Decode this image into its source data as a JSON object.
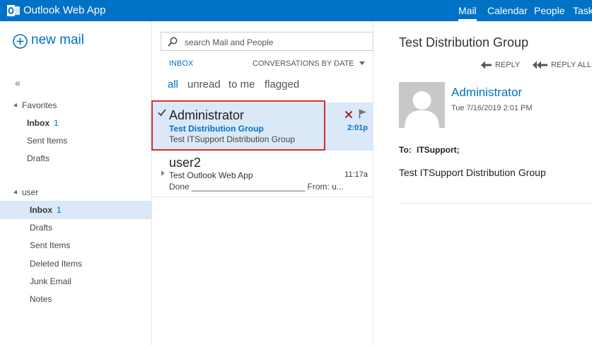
{
  "app": {
    "title": "Outlook Web App"
  },
  "topnav": {
    "mail": "Mail",
    "calendar": "Calendar",
    "people": "People",
    "tasks": "Task"
  },
  "colors": {
    "brand": "#0072c6",
    "selected_bg": "#dae8f7",
    "highlight": "#d62b2b"
  },
  "leftpane": {
    "new_mail": "new mail",
    "collapse": "«",
    "favorites": {
      "header": "Favorites",
      "items": [
        {
          "label": "Inbox",
          "count": "1"
        },
        {
          "label": "Sent Items"
        },
        {
          "label": "Drafts"
        }
      ]
    },
    "user": {
      "header": "user",
      "items": [
        {
          "label": "Inbox",
          "count": "1"
        },
        {
          "label": "Drafts"
        },
        {
          "label": "Sent Items"
        },
        {
          "label": "Deleted Items"
        },
        {
          "label": "Junk Email"
        },
        {
          "label": "Notes"
        }
      ]
    }
  },
  "midpane": {
    "search_placeholder": "search Mail and People",
    "folder_label": "INBOX",
    "sort_label": "CONVERSATIONS BY DATE",
    "filters": [
      "all",
      "unread",
      "to me",
      "flagged"
    ],
    "messages": [
      {
        "sender": "Administrator",
        "subject": "Test Distribution Group",
        "preview": "Test ITSupport Distribution Group",
        "time": "2:01p"
      },
      {
        "sender": "user2",
        "subject": "Test Outlook Web App",
        "preview": "Done ________________________ From: u...",
        "time": "11:17a"
      }
    ]
  },
  "readpane": {
    "subject": "Test Distribution Group",
    "reply": "REPLY",
    "reply_all": "REPLY ALL",
    "sender": "Administrator",
    "date": "Tue 7/16/2019 2:01 PM",
    "to_label": "To:",
    "to_value": "ITSupport;",
    "body": "Test ITSupport Distribution Group"
  }
}
